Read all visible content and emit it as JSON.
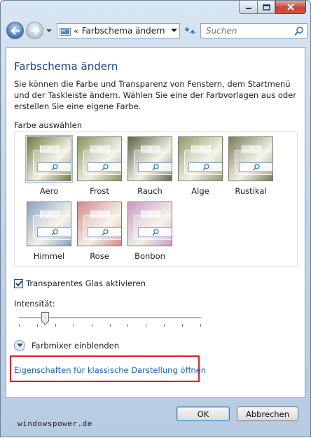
{
  "window": {
    "caption_buttons": [
      "minimize-icon",
      "maximize-icon",
      "close-icon"
    ]
  },
  "address_bar": {
    "separator": "«",
    "path": "Farbschema ändern",
    "folder_icon": "control-panel-folder-icon"
  },
  "search": {
    "placeholder": "Suchen"
  },
  "main": {
    "title": "Farbschema ändern",
    "description": "Sie können die Farbe und Transparenz von Fenstern, dem Startmenü und der Taskleiste ändern. Wählen Sie eine der Farbvorlagen aus oder erstellen Sie eine eigene Farbe.",
    "color_section_label": "Farbe auswählen",
    "swatches": [
      {
        "label": "Aero",
        "color": "#6f7a3e",
        "selected": true
      },
      {
        "label": "Frost",
        "color": "#8a9160"
      },
      {
        "label": "Rauch",
        "color": "#5c6548"
      },
      {
        "label": "Alge",
        "color": "#93986a"
      },
      {
        "label": "Rustikal",
        "color": "#7b7b5a"
      },
      {
        "label": "Himmel",
        "color": "#8aa1c4"
      },
      {
        "label": "Rose",
        "color": "#d28a8c"
      },
      {
        "label": "Bonbon",
        "color": "#c89ac6"
      }
    ],
    "transparency_checkbox_label": "Transparentes Glas aktivieren",
    "transparency_checked": true,
    "intensity_label": "Intensität:",
    "intensity_value": 0.13,
    "mixer_label": "Farbmixer einblenden",
    "classic_link": "Eigenschaften für klassische Darstellung öffnen"
  },
  "footer": {
    "ok": "OK",
    "cancel": "Abbrechen",
    "watermark": "windowspower.de"
  }
}
